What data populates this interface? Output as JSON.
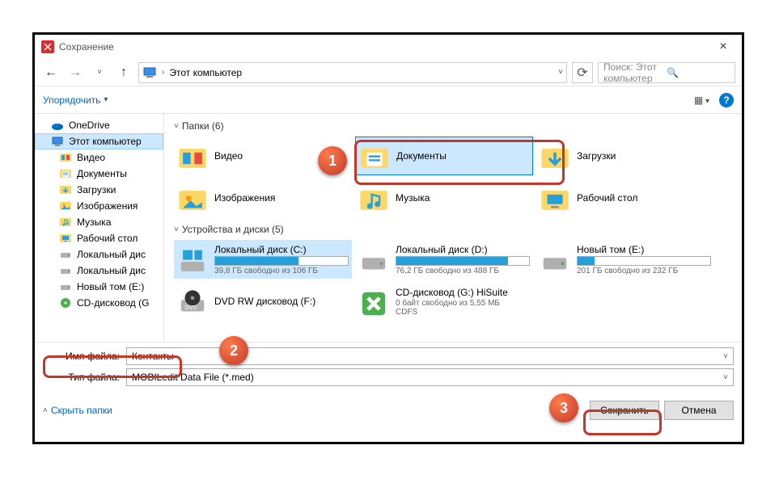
{
  "title": "Сохранение",
  "breadcrumb": "Этот компьютер",
  "search_placeholder": "Поиск: Этот компьютер",
  "organize_label": "Упорядочить",
  "sidebar": {
    "items": [
      {
        "label": "OneDrive",
        "icon": "onedrive"
      },
      {
        "label": "Этот компьютер",
        "icon": "pc",
        "selected": true
      },
      {
        "label": "Видео",
        "icon": "video",
        "indent": true
      },
      {
        "label": "Документы",
        "icon": "doc",
        "indent": true
      },
      {
        "label": "Загрузки",
        "icon": "download",
        "indent": true
      },
      {
        "label": "Изображения",
        "icon": "image",
        "indent": true
      },
      {
        "label": "Музыка",
        "icon": "music",
        "indent": true
      },
      {
        "label": "Рабочий стол",
        "icon": "desktop",
        "indent": true
      },
      {
        "label": "Локальный дис",
        "icon": "drive",
        "indent": true
      },
      {
        "label": "Локальный дис",
        "icon": "drive",
        "indent": true
      },
      {
        "label": "Новый том (E:)",
        "icon": "drive",
        "indent": true
      },
      {
        "label": "CD-дисковод (G",
        "icon": "cd",
        "indent": true
      }
    ]
  },
  "folders_header": "Папки (6)",
  "folders": [
    {
      "label": "Видео",
      "icon": "video"
    },
    {
      "label": "Документы",
      "icon": "doc",
      "selected": true
    },
    {
      "label": "Загрузки",
      "icon": "download"
    },
    {
      "label": "Изображения",
      "icon": "image"
    },
    {
      "label": "Музыка",
      "icon": "music"
    },
    {
      "label": "Рабочий стол",
      "icon": "desktop"
    }
  ],
  "drives_header": "Устройства и диски (5)",
  "drives": [
    {
      "name": "Локальный диск (C:)",
      "free": "39,8 ГБ свободно из 106 ГБ",
      "fill": 63,
      "selected": true,
      "icon": "windrive"
    },
    {
      "name": "Локальный диск (D:)",
      "free": "76,2 ГБ свободно из 488 ГБ",
      "fill": 84,
      "icon": "hdd"
    },
    {
      "name": "Новый том (E:)",
      "free": "201 ГБ свободно из 232 ГБ",
      "fill": 13,
      "icon": "hdd"
    },
    {
      "name": "DVD RW дисковод (F:)",
      "free": "",
      "nobar": true,
      "icon": "dvd"
    },
    {
      "name": "CD-дисковод (G:) HiSuite",
      "free": "0 байт свободно из 5,55 МБ",
      "sub": "CDFS",
      "nobar": true,
      "icon": "hisuite"
    }
  ],
  "filename_label": "Имя файла:",
  "filename_value": "Контакты",
  "filetype_label": "Тип файла:",
  "filetype_value": "MOBILedit Data File (*.med)",
  "hide_folders": "Скрыть папки",
  "save_label": "Сохранить",
  "cancel_label": "Отмена",
  "annotations": [
    "1",
    "2",
    "3"
  ]
}
